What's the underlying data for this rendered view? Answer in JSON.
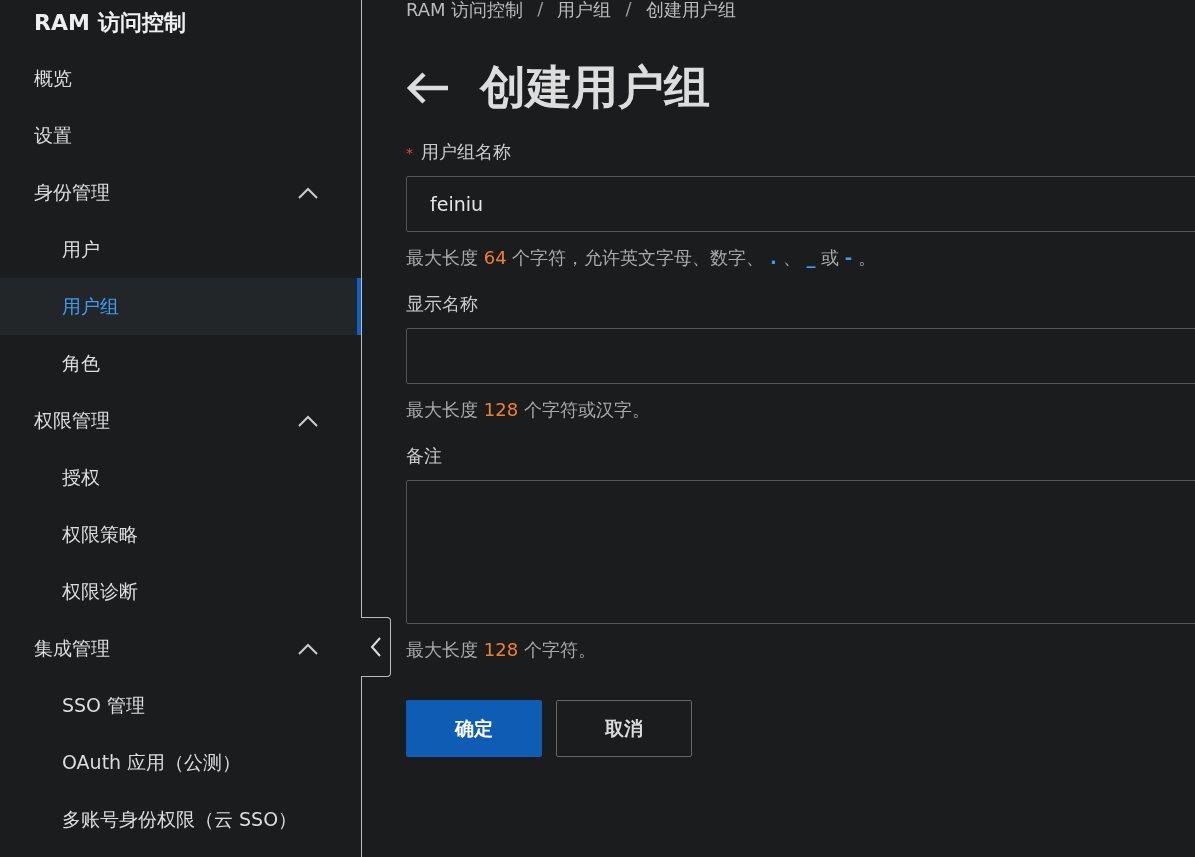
{
  "sidebar": {
    "title": "RAM 访问控制",
    "items": [
      {
        "label": "概览",
        "selected": false
      },
      {
        "label": "设置",
        "selected": false
      },
      {
        "label": "身份管理",
        "expanded": true,
        "children": [
          {
            "label": "用户",
            "selected": false
          },
          {
            "label": "用户组",
            "selected": true
          },
          {
            "label": "角色",
            "selected": false
          }
        ]
      },
      {
        "label": "权限管理",
        "expanded": true,
        "children": [
          {
            "label": "授权",
            "selected": false
          },
          {
            "label": "权限策略",
            "selected": false
          },
          {
            "label": "权限诊断",
            "selected": false
          }
        ]
      },
      {
        "label": "集成管理",
        "expanded": true,
        "children": [
          {
            "label": "SSO 管理",
            "selected": false
          },
          {
            "label": "OAuth 应用（公测）",
            "selected": false
          },
          {
            "label": "多账号身份权限（云 SSO）",
            "selected": false
          }
        ]
      }
    ]
  },
  "breadcrumb": [
    {
      "kind": "link",
      "text": "RAM 访问控制"
    },
    {
      "kind": "separator",
      "text": "/"
    },
    {
      "kind": "link",
      "text": "用户组"
    },
    {
      "kind": "separator",
      "text": "/"
    },
    {
      "kind": "link",
      "text": "创建用户组"
    }
  ],
  "page_title": "创建用户组",
  "fields": [
    {
      "label": "用户组名称",
      "required_mark": "*",
      "kind": "input",
      "value": "feiniu",
      "hint": [
        {
          "kind": "plain",
          "text": "最大长度 "
        },
        {
          "kind": "number",
          "text": "64"
        },
        {
          "kind": "plain",
          "text": " 个字符，允许英文字母、数字、 "
        },
        {
          "kind": "symbol",
          "text": "."
        },
        {
          "kind": "plain",
          "text": " 、 "
        },
        {
          "kind": "symbol",
          "text": "_"
        },
        {
          "kind": "plain",
          "text": " 或 "
        },
        {
          "kind": "symbol",
          "text": "-"
        },
        {
          "kind": "plain",
          "text": " 。"
        }
      ]
    },
    {
      "label": "显示名称",
      "kind": "input",
      "hint": [
        {
          "kind": "plain",
          "text": "最大长度 "
        },
        {
          "kind": "number",
          "text": "128"
        },
        {
          "kind": "plain",
          "text": " 个字符或汉字。"
        }
      ]
    },
    {
      "label": "备注",
      "kind": "textarea",
      "hint": [
        {
          "kind": "plain",
          "text": "最大长度 "
        },
        {
          "kind": "number",
          "text": "128"
        },
        {
          "kind": "plain",
          "text": " 个字符。"
        }
      ]
    }
  ],
  "buttons": [
    {
      "label": "确定",
      "kind": "primary"
    },
    {
      "label": "取消",
      "kind": "secondary"
    }
  ]
}
